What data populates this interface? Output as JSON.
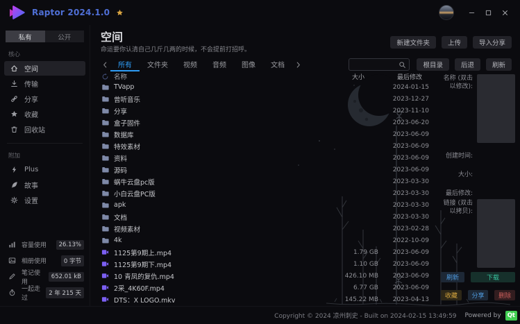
{
  "titlebar": {
    "title": "Raptor 2024.1.0"
  },
  "sidebar": {
    "tabs": [
      {
        "id": "private",
        "label": "私有",
        "active": true
      },
      {
        "id": "public",
        "label": "公开",
        "active": false
      }
    ],
    "sections": [
      {
        "label": "核心",
        "items": [
          {
            "id": "space",
            "label": "空间",
            "icon": "home",
            "active": true
          },
          {
            "id": "transfer",
            "label": "传输",
            "icon": "download",
            "active": false
          },
          {
            "id": "share",
            "label": "分享",
            "icon": "link",
            "active": false
          },
          {
            "id": "favorites",
            "label": "收藏",
            "icon": "star",
            "active": false
          },
          {
            "id": "recycle-bin",
            "label": "回收站",
            "icon": "trash",
            "active": false
          }
        ]
      },
      {
        "label": "附加",
        "items": [
          {
            "id": "plus",
            "label": "Plus",
            "icon": "bolt",
            "active": false
          },
          {
            "id": "story",
            "label": "故事",
            "icon": "feather",
            "active": false
          },
          {
            "id": "settings",
            "label": "设置",
            "icon": "gear",
            "active": false
          }
        ]
      }
    ],
    "stats": [
      {
        "id": "capacity-usage",
        "label": "容量使用",
        "value": "26.13%",
        "icon": "chart"
      },
      {
        "id": "album-usage",
        "label": "相册使用",
        "value": "0 字节",
        "icon": "image"
      },
      {
        "id": "notes-usage",
        "label": "笔记使用",
        "value": "652.01 kB",
        "icon": "pen"
      },
      {
        "id": "days-together",
        "label": "一起走过",
        "value": "2 年 215 天",
        "icon": "watch"
      }
    ]
  },
  "header": {
    "title": "空间",
    "subtitle": "命运要你认清自己几斤几两的时候，不会提前打招呼。",
    "actions": [
      {
        "id": "new-folder",
        "label": "新建文件夹"
      },
      {
        "id": "upload",
        "label": "上传"
      },
      {
        "id": "import-share",
        "label": "导入分享"
      }
    ]
  },
  "toolbar": {
    "tabs": [
      {
        "id": "all",
        "label": "所有",
        "active": true
      },
      {
        "id": "folders",
        "label": "文件夹",
        "active": false
      },
      {
        "id": "videos",
        "label": "视频",
        "active": false
      },
      {
        "id": "audio",
        "label": "音频",
        "active": false
      },
      {
        "id": "images",
        "label": "图像",
        "active": false
      },
      {
        "id": "docs",
        "label": "文档",
        "active": false
      }
    ],
    "search_placeholder": "",
    "buttons": [
      {
        "id": "root-dir",
        "label": "根目录"
      },
      {
        "id": "back",
        "label": "后退"
      },
      {
        "id": "refresh",
        "label": "刷新"
      }
    ]
  },
  "table": {
    "columns": {
      "name": "名称",
      "size": "大小",
      "modified": "最后修改"
    },
    "rows": [
      {
        "name": "TVapp",
        "type": "folder",
        "size": "",
        "modified": "2024-01-15"
      },
      {
        "name": "曾听音乐",
        "type": "folder",
        "size": "",
        "modified": "2023-12-27"
      },
      {
        "name": "分享",
        "type": "folder",
        "size": "",
        "modified": "2023-11-10"
      },
      {
        "name": "盒子固件",
        "type": "folder",
        "size": "",
        "modified": "2023-06-20"
      },
      {
        "name": "数据库",
        "type": "folder",
        "size": "",
        "modified": "2023-06-09"
      },
      {
        "name": "特效素材",
        "type": "folder",
        "size": "",
        "modified": "2023-06-09"
      },
      {
        "name": "资料",
        "type": "folder",
        "size": "",
        "modified": "2023-06-09"
      },
      {
        "name": "源码",
        "type": "folder",
        "size": "",
        "modified": "2023-06-09"
      },
      {
        "name": "蜗牛云盘pc版",
        "type": "folder",
        "size": "",
        "modified": "2023-03-30"
      },
      {
        "name": "小白云盘PC版",
        "type": "folder",
        "size": "",
        "modified": "2023-03-30"
      },
      {
        "name": "apk",
        "type": "folder",
        "size": "",
        "modified": "2023-03-30"
      },
      {
        "name": "文档",
        "type": "folder",
        "size": "",
        "modified": "2023-03-30"
      },
      {
        "name": "视频素材",
        "type": "folder",
        "size": "",
        "modified": "2023-02-28"
      },
      {
        "name": "4k",
        "type": "folder",
        "size": "",
        "modified": "2022-10-09"
      },
      {
        "name": "1125第9期上.mp4",
        "type": "video",
        "size": "1.79 GB",
        "modified": "2023-06-09"
      },
      {
        "name": "1125第9期下.mp4",
        "type": "video",
        "size": "1.10 GB",
        "modified": "2023-06-09"
      },
      {
        "name": "10 青凤的复仇.mp4",
        "type": "video",
        "size": "426.10 MB",
        "modified": "2023-06-09"
      },
      {
        "name": "2采_4K60F.mp4",
        "type": "video",
        "size": "6.77 GB",
        "modified": "2023-06-09"
      },
      {
        "name": "DTS：X LOGO.mkv",
        "type": "video",
        "size": "145.22 MB",
        "modified": "2023-04-13"
      }
    ]
  },
  "details": {
    "fields": [
      {
        "id": "name",
        "label": "名称 (双击以修改):",
        "has_box": true,
        "value": ""
      },
      {
        "id": "created",
        "label": "创建时间:",
        "has_box": false,
        "value": ""
      },
      {
        "id": "size",
        "label": "大小:",
        "has_box": false,
        "value": ""
      },
      {
        "id": "modified",
        "label": "最后修改:",
        "has_box": false,
        "value": ""
      },
      {
        "id": "link",
        "label": "链接 (双击以拷贝):",
        "has_box": true,
        "value": ""
      }
    ],
    "button_rows": [
      [
        {
          "id": "refresh-detail",
          "label": "刷新",
          "style": "blue",
          "grow": false
        },
        {
          "id": "download",
          "label": "下载",
          "style": "teal",
          "grow": true
        }
      ],
      [
        {
          "id": "favorite",
          "label": "收藏",
          "style": "yellow",
          "grow": true
        },
        {
          "id": "share-file",
          "label": "分享",
          "style": "blue",
          "grow": true
        },
        {
          "id": "delete",
          "label": "删除",
          "style": "red",
          "grow": true
        }
      ]
    ]
  },
  "statusbar": {
    "copyright": "Copyright © 2024 凉州刺史 - Built on 2024-02-15 13:49:59",
    "powered_by": "Powered by",
    "qt_label": "Qt"
  },
  "colors": {
    "accent_blue": "#2e9cf5",
    "title_blue": "#4f6fd6",
    "folder_icon": "#7e89a8",
    "video_icon": "#7b5ff2",
    "download_teal": "#38c4a0",
    "favorite_yellow": "#d3a43e",
    "delete_red": "#cd5f5c",
    "qt_green": "#41cd52",
    "star_gold": "#d9a441"
  }
}
